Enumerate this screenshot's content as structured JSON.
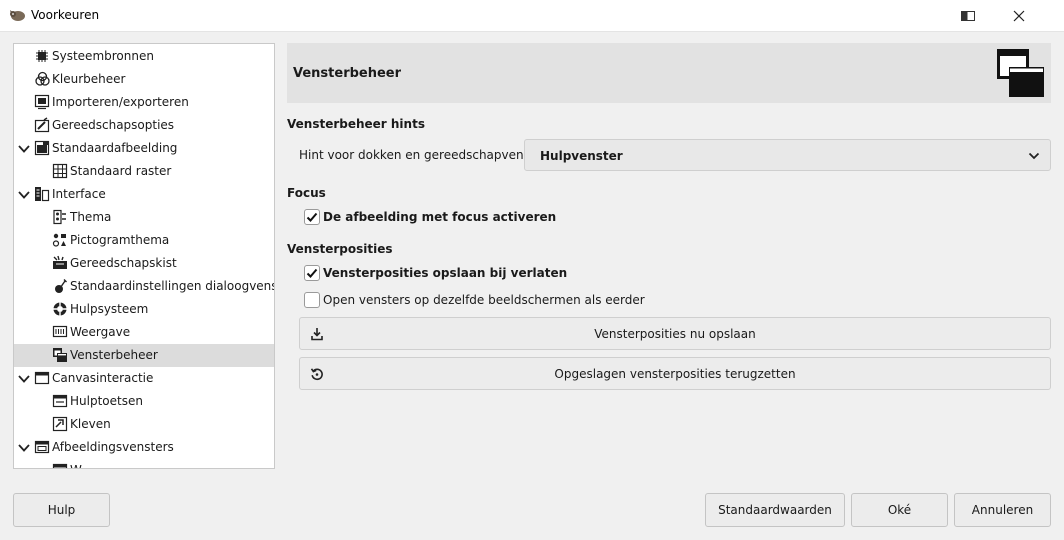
{
  "window": {
    "title": "Voorkeuren",
    "app_icon": "gimp-wilber-icon",
    "pin_icon": "keep-above-icon",
    "close_icon": "close-icon"
  },
  "tree": {
    "items": [
      {
        "label": "Systeembronnen",
        "icon": "chip-icon",
        "level": 0,
        "expanded": null
      },
      {
        "label": "Kleurbeheer",
        "icon": "color-circles-icon",
        "level": 0,
        "expanded": null
      },
      {
        "label": "Importeren/exporteren",
        "icon": "import-export-icon",
        "level": 0,
        "expanded": null
      },
      {
        "label": "Gereedschapsopties",
        "icon": "tool-options-icon",
        "level": 0,
        "expanded": null
      },
      {
        "label": "Standaardafbeelding",
        "icon": "image-default-icon",
        "level": 0,
        "expanded": true
      },
      {
        "label": "Standaard raster",
        "icon": "grid-icon",
        "level": 1,
        "expanded": null
      },
      {
        "label": "Interface",
        "icon": "interface-icon",
        "level": 0,
        "expanded": true
      },
      {
        "label": "Thema",
        "icon": "theme-icon",
        "level": 1,
        "expanded": null
      },
      {
        "label": "Pictogramthema",
        "icon": "icon-theme-icon",
        "level": 1,
        "expanded": null
      },
      {
        "label": "Gereedschapskist",
        "icon": "toolbox-icon",
        "level": 1,
        "expanded": null
      },
      {
        "label": "Standaardinstellingen dialoogvensters",
        "icon": "dialog-defaults-icon",
        "level": 1,
        "expanded": null
      },
      {
        "label": "Hulpsysteem",
        "icon": "help-lifebuoy-icon",
        "level": 1,
        "expanded": null
      },
      {
        "label": "Weergave",
        "icon": "display-icon",
        "level": 1,
        "expanded": null
      },
      {
        "label": "Vensterbeheer",
        "icon": "window-management-icon",
        "level": 1,
        "expanded": null,
        "selected": true
      },
      {
        "label": "Canvasinteractie",
        "icon": "canvas-icon",
        "level": 0,
        "expanded": true
      },
      {
        "label": "Hulptoetsen",
        "icon": "modifier-keys-icon",
        "level": 1,
        "expanded": null
      },
      {
        "label": "Kleven",
        "icon": "snapping-icon",
        "level": 1,
        "expanded": null
      },
      {
        "label": "Afbeeldingsvensters",
        "icon": "image-windows-icon",
        "level": 0,
        "expanded": true
      },
      {
        "label": "W...",
        "icon": "window-icon",
        "level": 1,
        "expanded": null
      }
    ]
  },
  "banner": {
    "title": "Vensterbeheer",
    "icon": "window-management-icon"
  },
  "hints": {
    "section_title": "Vensterbeheer hints",
    "label": "Hint voor dokken en gereedschapvenster:",
    "selected": "Hulpvenster",
    "arrow_icon": "chevron-down-icon"
  },
  "focus": {
    "section_title": "Focus",
    "activate_label": "De afbeelding met focus activeren",
    "activate_checked": true
  },
  "positions": {
    "section_title": "Vensterposities",
    "save_on_exit_label": "Vensterposities opslaan bij verlaten",
    "save_on_exit_checked": true,
    "same_monitor_label": "Open vensters op dezelfde beeldschermen als eerder",
    "same_monitor_checked": false,
    "save_now_label": "Vensterposities nu opslaan",
    "save_now_icon": "save-download-icon",
    "reset_label": "Opgeslagen vensterposities terugzetten",
    "reset_icon": "reset-undo-icon"
  },
  "footer": {
    "help_label": "Hulp",
    "defaults_label": "Standaardwaarden",
    "ok_label": "Oké",
    "cancel_label": "Annuleren"
  }
}
